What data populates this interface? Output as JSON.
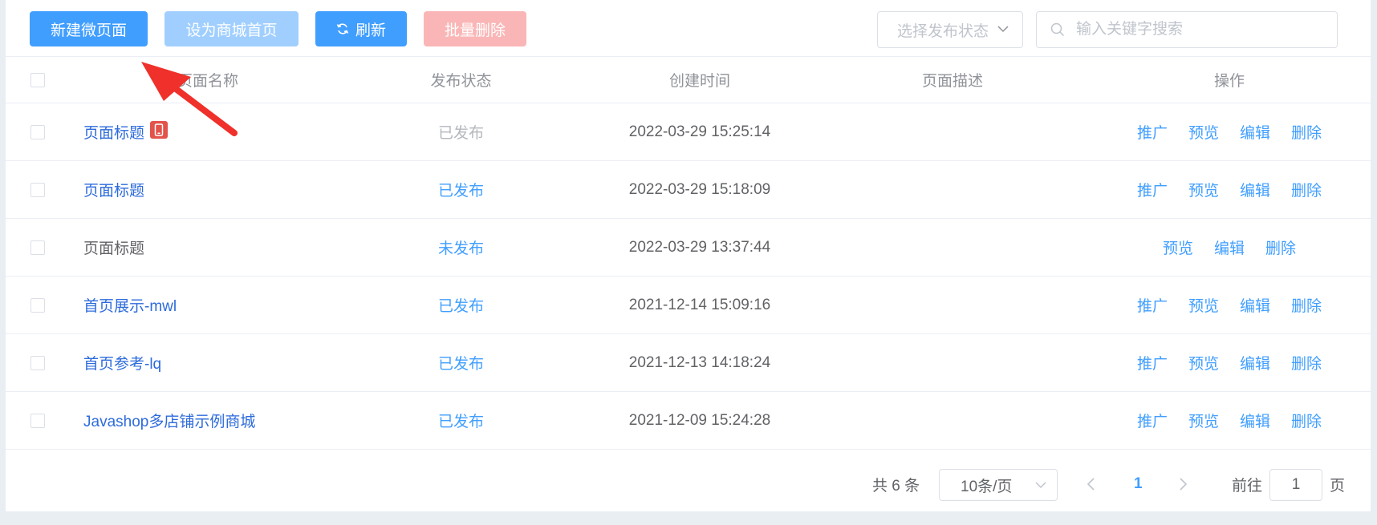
{
  "toolbar": {
    "create_label": "新建微页面",
    "set_home_label": "设为商城首页",
    "refresh_label": "刷新",
    "batch_delete_label": "批量删除",
    "status_select_placeholder": "选择发布状态",
    "search_placeholder": "输入关键字搜索"
  },
  "table": {
    "columns": [
      "页面名称",
      "发布状态",
      "创建时间",
      "页面描述",
      "操作"
    ],
    "rows": [
      {
        "name": "页面标题",
        "status": "已发布",
        "time": "2022-03-29 15:25:14",
        "desc": "",
        "ops": [
          "推广",
          "预览",
          "编辑",
          "删除"
        ]
      },
      {
        "name": "页面标题",
        "status": "已发布",
        "time": "2022-03-29 15:18:09",
        "desc": "",
        "ops": [
          "推广",
          "预览",
          "编辑",
          "删除"
        ]
      },
      {
        "name": "页面标题",
        "status": "未发布",
        "time": "2022-03-29 13:37:44",
        "desc": "",
        "ops": [
          "预览",
          "编辑",
          "删除"
        ]
      },
      {
        "name": "首页展示-mwl",
        "status": "已发布",
        "time": "2021-12-14 15:09:16",
        "desc": "",
        "ops": [
          "推广",
          "预览",
          "编辑",
          "删除"
        ]
      },
      {
        "name": "首页参考-lq",
        "status": "已发布",
        "time": "2021-12-13 14:18:24",
        "desc": "",
        "ops": [
          "推广",
          "预览",
          "编辑",
          "删除"
        ]
      },
      {
        "name": "Javashop多店铺示例商城",
        "status": "已发布",
        "time": "2021-12-09 15:24:28",
        "desc": "",
        "ops": [
          "推广",
          "预览",
          "编辑",
          "删除"
        ]
      }
    ]
  },
  "pagination": {
    "total_label": "共 6 条",
    "page_size": "10条/页",
    "current_page": "1",
    "goto_label": "前往",
    "goto_value": "1",
    "page_unit": "页"
  },
  "colors": {
    "primary": "#409eff",
    "primary_disabled": "#a0cfff",
    "danger_disabled": "#fab6b6",
    "annotation_arrow": "#f0302a"
  }
}
